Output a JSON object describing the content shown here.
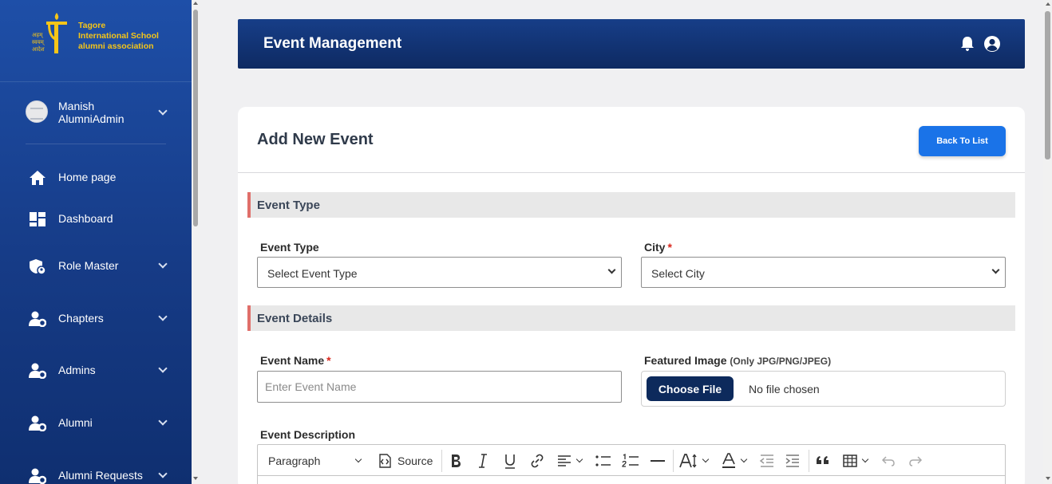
{
  "brand": {
    "line1": "Tagore",
    "line2": "International School",
    "line3": "alumni association",
    "hindi": [
      "अहम्",
      "स्वयम्",
      "आदेश"
    ],
    "color": "#f5c518"
  },
  "user": {
    "first": "Manish",
    "second": "AlumniAdmin"
  },
  "sidebar": {
    "items": [
      {
        "label": "Home page",
        "icon": "home-icon"
      },
      {
        "label": "Dashboard",
        "icon": "dashboard-icon"
      },
      {
        "label": "Role Master",
        "icon": "shield-user-icon"
      },
      {
        "label": "Chapters",
        "icon": "user-gear-icon"
      },
      {
        "label": "Admins",
        "icon": "user-gear-icon"
      },
      {
        "label": "Alumni",
        "icon": "user-gear-icon"
      },
      {
        "label": "Alumni Requests",
        "icon": "user-gear-icon"
      }
    ]
  },
  "header": {
    "title": "Event Management",
    "accent": "#0e2a62"
  },
  "page": {
    "title": "Add New Event",
    "back_button": "Back To List",
    "sections": {
      "type": "Event Type",
      "details": "Event Details"
    }
  },
  "form": {
    "event_type": {
      "label": "Event Type",
      "value": "Select Event Type"
    },
    "city": {
      "label": "City",
      "required": "*",
      "value": "Select City"
    },
    "event_name": {
      "label": "Event Name",
      "required": "*",
      "placeholder": "Enter Event Name"
    },
    "featured_image": {
      "label": "Featured Image",
      "hint": "(Only JPG/PNG/JPEG)",
      "button": "Choose File",
      "status": "No file chosen"
    },
    "description": {
      "label": "Event Description"
    }
  },
  "editor": {
    "paragraph": "Paragraph",
    "source": "Source"
  },
  "colors": {
    "primary_button": "#1a73e8",
    "section_accent": "#e06f6a",
    "required": "#d9261c"
  }
}
